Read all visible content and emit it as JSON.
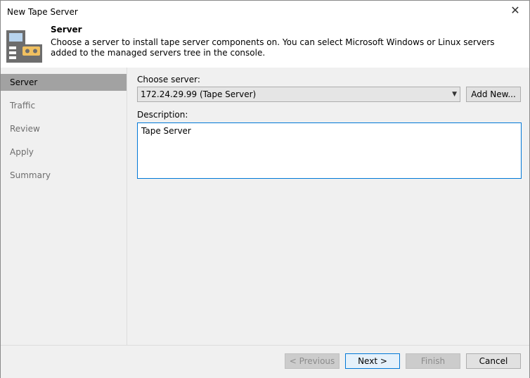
{
  "window": {
    "title": "New Tape Server",
    "close_icon": "close-icon"
  },
  "header": {
    "title": "Server",
    "description": "Choose a server to install tape server components on. You can select Microsoft Windows or Linux servers added to the managed servers tree in the console."
  },
  "sidebar": {
    "items": [
      {
        "label": "Server",
        "selected": true
      },
      {
        "label": "Traffic"
      },
      {
        "label": "Review"
      },
      {
        "label": "Apply"
      },
      {
        "label": "Summary"
      }
    ]
  },
  "main": {
    "choose_label": "Choose server:",
    "server_value": "172.24.29.99 (Tape Server)",
    "add_new_label": "Add New...",
    "description_label": "Description:",
    "description_value": "Tape Server"
  },
  "footer": {
    "previous": "< Previous",
    "next": "Next >",
    "finish": "Finish",
    "cancel": "Cancel"
  }
}
